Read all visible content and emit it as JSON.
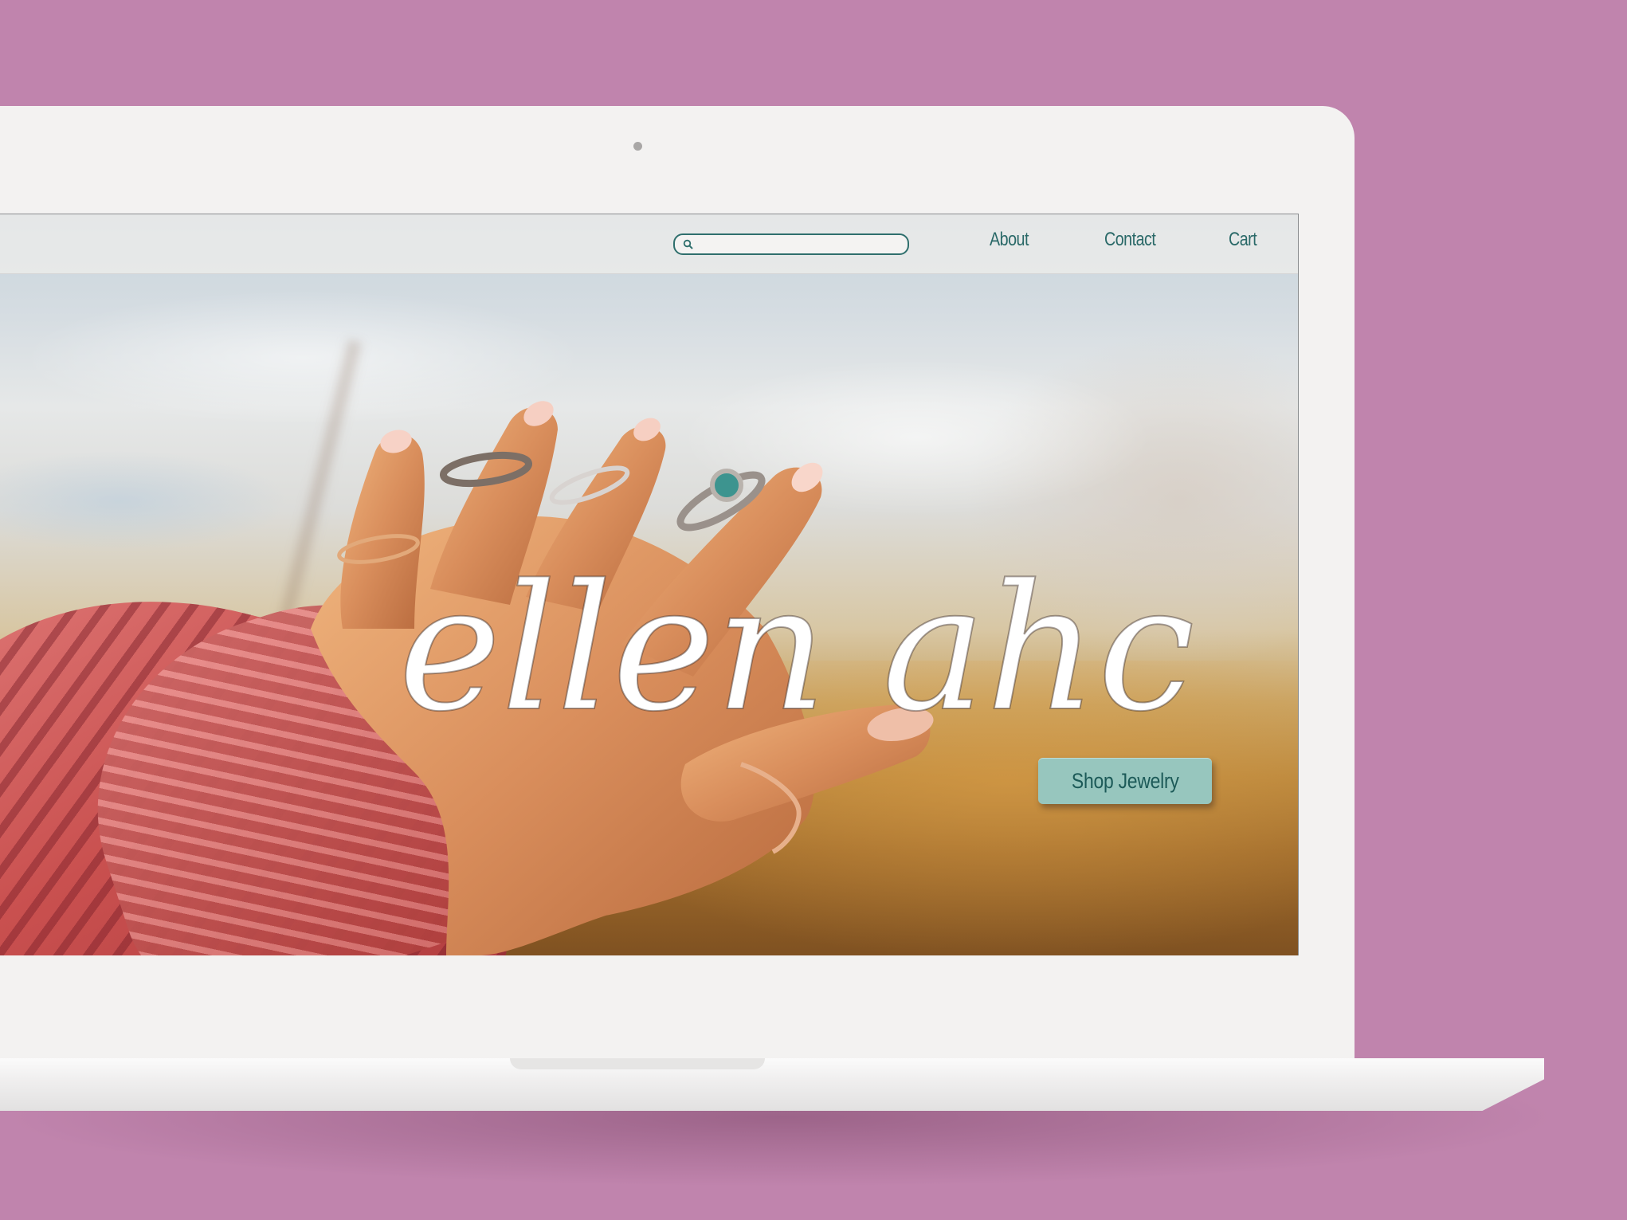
{
  "site": {
    "brand_name": "ellen ahc"
  },
  "header": {
    "search_placeholder": "",
    "search_value": "",
    "nav": [
      {
        "label": "About"
      },
      {
        "label": "Contact"
      },
      {
        "label": "Cart"
      }
    ]
  },
  "hero": {
    "cta_label": "Shop Jewelry"
  },
  "colors": {
    "backdrop": "#c084ad",
    "accent_teal": "#2a6968",
    "cta_background": "#97c6be",
    "brand_text": "#ffffff"
  },
  "icons": {
    "search": "magnifier-icon"
  }
}
